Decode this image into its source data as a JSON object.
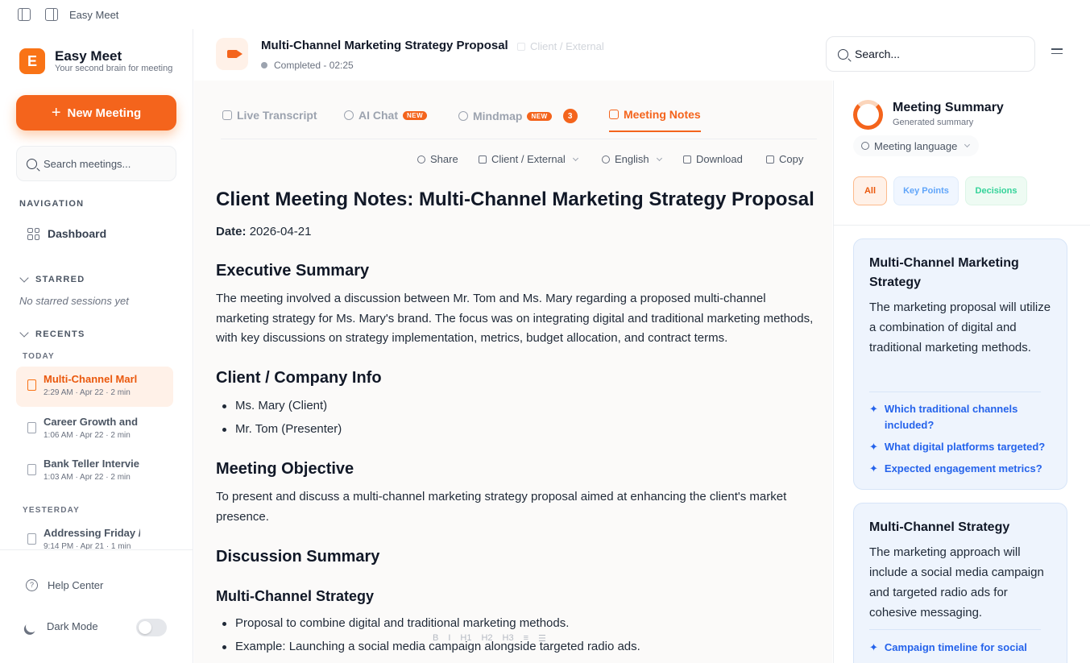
{
  "window": {
    "app_title": "Easy Meet"
  },
  "brand": {
    "name": "Easy Meet",
    "tagline": "Your second brain for meeting",
    "logo_letter": "E"
  },
  "sidebar": {
    "new_meeting": "New Meeting",
    "search_placeholder": "Search meetings...",
    "navigation_title": "NAVIGATION",
    "dashboard": "Dashboard",
    "starred_title": "STARRED",
    "no_starred": "No starred sessions yet",
    "recents_title": "RECENTS",
    "today": "TODAY",
    "yesterday": "YESTERDAY",
    "recents": [
      {
        "title": "Multi-Channel Marl",
        "meta": "2:29 AM · Apr 22 · 2 min"
      },
      {
        "title": "Career Growth and",
        "meta": "1:06 AM · Apr 22 · 2 min"
      },
      {
        "title": "Bank Teller Intervie",
        "meta": "1:03 AM · Apr 22 · 2 min"
      },
      {
        "title": "Addressing Friday /",
        "meta": "9:14 PM · Apr 21 · 1 min"
      }
    ],
    "help": "Help Center",
    "dark_mode": "Dark Mode"
  },
  "meeting": {
    "title": "Multi-Channel Marketing Strategy Proposal",
    "tag": "Client / External",
    "status": "Completed - 02:25"
  },
  "search": {
    "placeholder": "Search..."
  },
  "tabs": [
    {
      "label": "Live Transcript"
    },
    {
      "label": "AI Chat",
      "badge": "NEW"
    },
    {
      "label": "Mindmap",
      "badge": "NEW",
      "count": "3"
    },
    {
      "label": "Meeting Notes"
    }
  ],
  "toolbar": {
    "share": "Share",
    "client": "Client / External",
    "language": "English",
    "download": "Download",
    "copy": "Copy"
  },
  "notes": {
    "title": "Client Meeting Notes: Multi-Channel Marketing Strategy Proposal",
    "date_label": "Date:",
    "date_value": "2026-04-21",
    "exec_heading": "Executive Summary",
    "exec_text": "The meeting involved a discussion between Mr. Tom and Ms. Mary regarding a proposed multi-channel marketing strategy for Ms. Mary's brand. The focus was on integrating digital and traditional marketing methods, with key discussions on strategy implementation, metrics, budget allocation, and contract terms.",
    "client_heading": "Client / Company Info",
    "client_items": [
      "Ms. Mary (Client)",
      "Mr. Tom (Presenter)"
    ],
    "objective_heading": "Meeting Objective",
    "objective_text": "To present and discuss a multi-channel marketing strategy proposal aimed at enhancing the client's market presence.",
    "discussion_heading": "Discussion Summary",
    "mc_heading": "Multi-Channel Strategy",
    "mc_items": [
      "Proposal to combine digital and traditional marketing methods.",
      "Example: Launching a social media campaign alongside targeted radio ads."
    ]
  },
  "format_bar": [
    "B",
    "I",
    "H1",
    "H2",
    "H3",
    "≡",
    "☰"
  ],
  "summary": {
    "title": "Meeting Summary",
    "subtitle": "Generated summary",
    "language_btn": "Meeting language",
    "filters": {
      "all": "All",
      "key_points": "Key Points",
      "decisions": "Decisions"
    },
    "cards": [
      {
        "heading": "Multi-Channel Marketing Strategy",
        "text": "The marketing proposal will utilize a combination of digital and traditional marketing methods.",
        "questions": [
          "Which traditional channels included?",
          "What digital platforms targeted?",
          "Expected engagement metrics?"
        ]
      },
      {
        "heading": "Multi-Channel Strategy",
        "text": "The marketing approach will include a social media campaign and targeted radio ads for cohesive messaging.",
        "questions": [
          "Campaign timeline for social"
        ]
      }
    ]
  },
  "colors": {
    "accent": "#f4641c",
    "link": "#2563eb",
    "card_bg": "#eef4fd"
  }
}
